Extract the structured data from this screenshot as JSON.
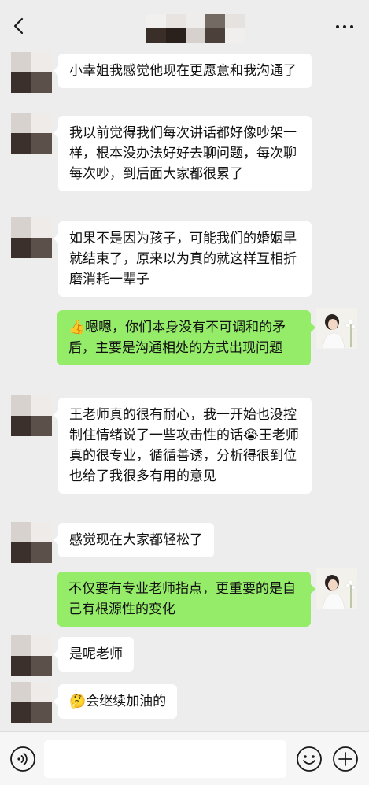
{
  "header": {
    "back_icon": "chevron-left-icon",
    "more_icon": "more-dots-icon"
  },
  "messages": [
    {
      "side": "left",
      "text": "小幸姐我感觉他现在更愿意和我沟通了"
    },
    {
      "side": "left",
      "text": "我以前觉得我们每次讲话都好像吵架一样，根本没办法好好去聊问题，每次聊每次吵，到后面大家都很累了"
    },
    {
      "side": "left",
      "text": "如果不是因为孩子，可能我们的婚姻早就结束了，原来以为真的就这样互相折磨消耗一辈子"
    },
    {
      "side": "right",
      "emoji": "👍",
      "text": "嗯嗯，你们本身没有不可调和的矛盾，主要是沟通相处的方式出现问题"
    },
    {
      "side": "left",
      "text_a": "王老师真的很有耐心，我一开始也没控制住情绪说了一些攻击性的话",
      "emoji": "😭",
      "text_b": "王老师真的很专业，循循善诱，分析得很到位也给了我很多有用的意见"
    },
    {
      "side": "left",
      "text": "感觉现在大家都轻松了"
    },
    {
      "side": "right",
      "text": "不仅要有专业老师指点，更重要的是自己有根源性的变化"
    },
    {
      "side": "left",
      "text": "是呢老师"
    },
    {
      "side": "left",
      "emoji": "🤔",
      "text": "会继续加油的"
    }
  ],
  "input_bar": {
    "voice_icon": "voice-icon",
    "emoji_icon": "smiley-icon",
    "plus_icon": "plus-icon",
    "input_value": ""
  },
  "colors": {
    "background": "#ededed",
    "incoming_bubble": "#ffffff",
    "outgoing_bubble": "#95ec69"
  }
}
